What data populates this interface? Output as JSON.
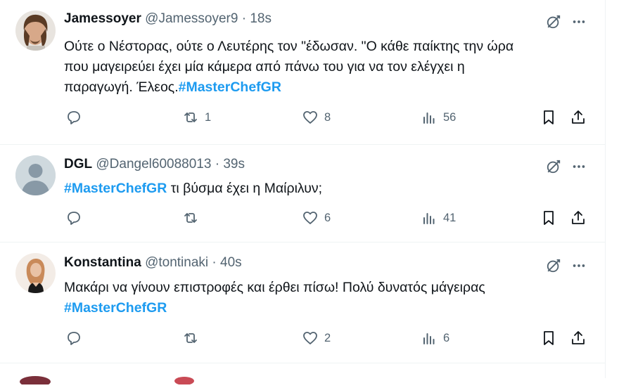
{
  "tweets": [
    {
      "name": "Jamessoyer",
      "handle": "@Jamessoyer9",
      "sep": "·",
      "time": "18s",
      "line1": "Ούτε ο Νέστορας, ούτε ο Λευτέρης τον \"έδωσαν. \"Ο κάθε παίκτης την ώρα",
      "line2": "που μαγειρεύει έχει μία κάμερα από πάνω του για να τον ελέγχει η",
      "line3_text": "παραγωγή. Έλεος.",
      "hashtag": "#MasterChefGR",
      "retweets": "1",
      "likes": "8",
      "views": "56"
    },
    {
      "name": "DGL",
      "handle": "@Dangel60088013",
      "sep": "·",
      "time": "39s",
      "hashtag": "#MasterChefGR",
      "text": " τι βύσμα έχει η Μαίριλυν;",
      "retweets": "",
      "likes": "6",
      "views": "41"
    },
    {
      "name": "Konstantina",
      "handle": "@tontinaki",
      "sep": "·",
      "time": "40s",
      "line1": "Μακάρι να γίνουν επιστροφές και έρθει πίσω! Πολύ δυνατός μάγειρας",
      "hashtag": "#MasterChefGR",
      "retweets": "",
      "likes": "2",
      "views": "6"
    }
  ],
  "colors": {
    "accent": "#1d9bf0",
    "muted": "#536471",
    "text": "#0f1419"
  },
  "icons": [
    "grok-icon",
    "more-icon",
    "reply-icon",
    "retweet-icon",
    "like-icon",
    "views-icon",
    "bookmark-icon",
    "share-icon"
  ]
}
